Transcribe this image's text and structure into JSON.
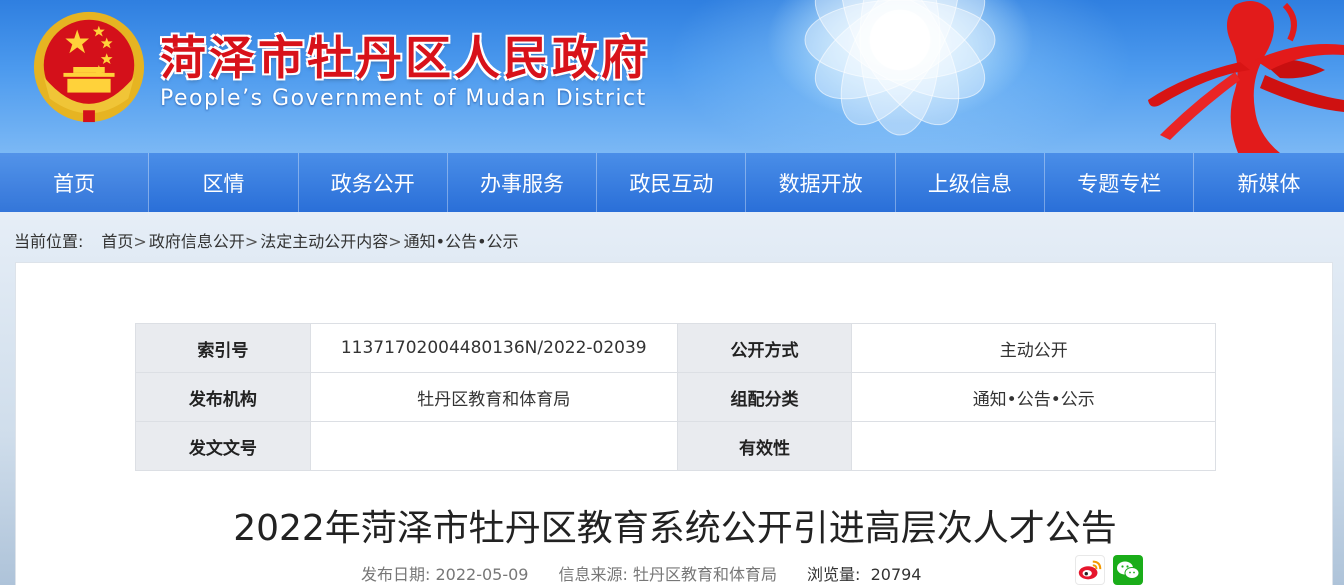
{
  "header": {
    "title": "菏泽市牡丹区人民政府",
    "subtitle": "People’s Government of Mudan District",
    "emblem_icon": "national-emblem-icon",
    "colors": {
      "title": "#d8121a",
      "banner": "#3a86e6"
    }
  },
  "nav": {
    "items": [
      {
        "label": "首页"
      },
      {
        "label": "区情"
      },
      {
        "label": "政务公开"
      },
      {
        "label": "办事服务"
      },
      {
        "label": "政民互动"
      },
      {
        "label": "数据开放"
      },
      {
        "label": "上级信息"
      },
      {
        "label": "专题专栏"
      },
      {
        "label": "新媒体"
      }
    ]
  },
  "breadcrumb": {
    "label": "当前位置:",
    "items": [
      {
        "text": "首页",
        "sep": ">"
      },
      {
        "text": "政府信息公开",
        "sep": ">"
      },
      {
        "text": "法定主动公开内容",
        "sep": ">"
      },
      {
        "text": "通知•公告•公示",
        "sep": ""
      }
    ]
  },
  "meta": {
    "rows": [
      {
        "k1": "索引号",
        "v1": "11371702004480136N/2022-02039",
        "k2": "公开方式",
        "v2": "主动公开"
      },
      {
        "k1": "发布机构",
        "v1": "牡丹区教育和体育局",
        "k2": "组配分类",
        "v2": "通知•公告•公示"
      },
      {
        "k1": "发文文号",
        "v1": "",
        "k2": "有效性",
        "v2": ""
      }
    ]
  },
  "article": {
    "title": "2022年菏泽市牡丹区教育系统公开引进高层次人才公告",
    "date_label": "发布日期:",
    "date": "2022-05-09",
    "source_label": "信息来源:",
    "source": "牡丹区教育和体育局",
    "views_label": "浏览量:",
    "views": "20794"
  },
  "share": {
    "weibo_icon": "weibo-icon",
    "wechat_icon": "wechat-icon"
  }
}
